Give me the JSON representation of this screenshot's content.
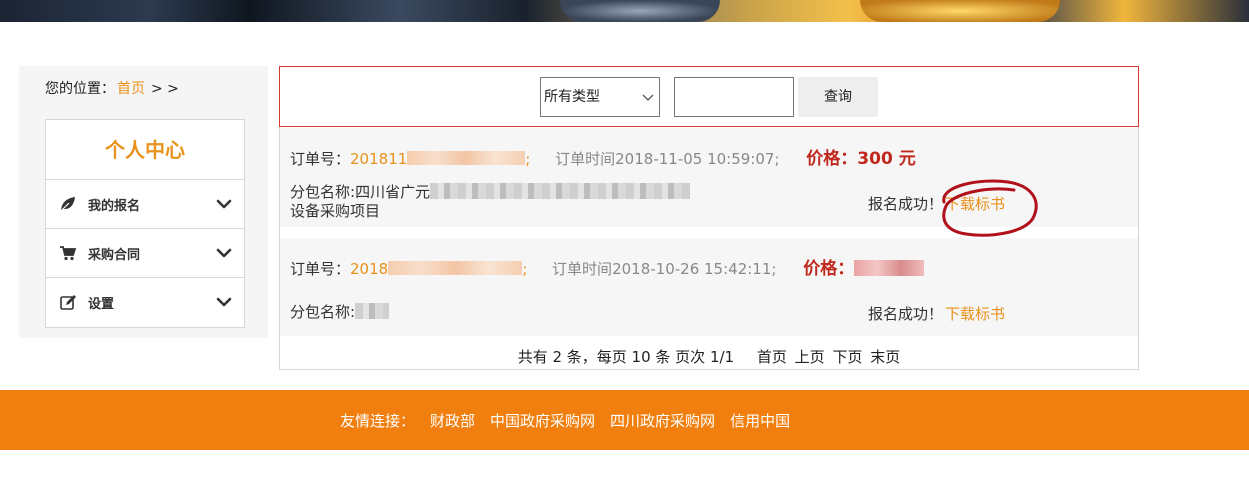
{
  "breadcrumb": {
    "prefix": "您的位置：",
    "home": "首页",
    "separator": "> >"
  },
  "sidebar": {
    "title": "个人中心",
    "items": [
      {
        "label": "我的报名",
        "icon": "leaf-icon"
      },
      {
        "label": "采购合同",
        "icon": "cart-icon"
      },
      {
        "label": "设置",
        "icon": "edit-icon"
      }
    ]
  },
  "search": {
    "type_selected": "所有类型",
    "keyword_value": "",
    "button_label": "查询"
  },
  "orders": [
    {
      "order_label": "订单号：",
      "order_no_visible": "201811",
      "time_label": "订单时间",
      "time_value": "2018-11-05 10:59:07;",
      "price_label": "价格：",
      "price_value": "300 元",
      "package_label": "分包名称:",
      "package_name_visible": "四川省广元",
      "package_name_line2": "设备采购项目",
      "status_text": "报名成功！",
      "download_label": "下载标书"
    },
    {
      "order_label": "订单号：",
      "order_no_visible": "2018",
      "time_label": "订单时间",
      "time_value": "2018-10-26 15:42:11;",
      "price_label": "价格：",
      "price_value": "",
      "package_label": "分包名称:",
      "package_name_visible": "",
      "package_name_line2": "",
      "status_text": "报名成功！",
      "download_label": "下载标书"
    }
  ],
  "pager": {
    "summary": "共有 2 条，每页 10 条  页次 1/1",
    "first": "首页",
    "prev": "上页",
    "next": "下页",
    "last": "末页"
  },
  "footer": {
    "label": "友情连接：",
    "links": [
      "财政部",
      "中国政府采购网",
      "四川政府采购网",
      "信用中国"
    ]
  },
  "colors": {
    "accent": "#e8911c",
    "price": "#c0281d",
    "footer_bg": "#f07f0f",
    "search_border": "#d43a2f"
  }
}
